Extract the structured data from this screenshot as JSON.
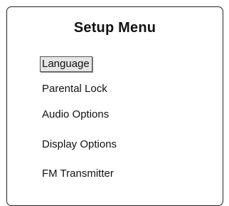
{
  "menu": {
    "title": "Setup Menu",
    "selected_index": 0,
    "items": [
      {
        "label": "Language"
      },
      {
        "label": "Parental Lock"
      },
      {
        "label": "Audio Options"
      },
      {
        "label": "Display Options"
      },
      {
        "label": "FM Transmitter"
      }
    ]
  }
}
